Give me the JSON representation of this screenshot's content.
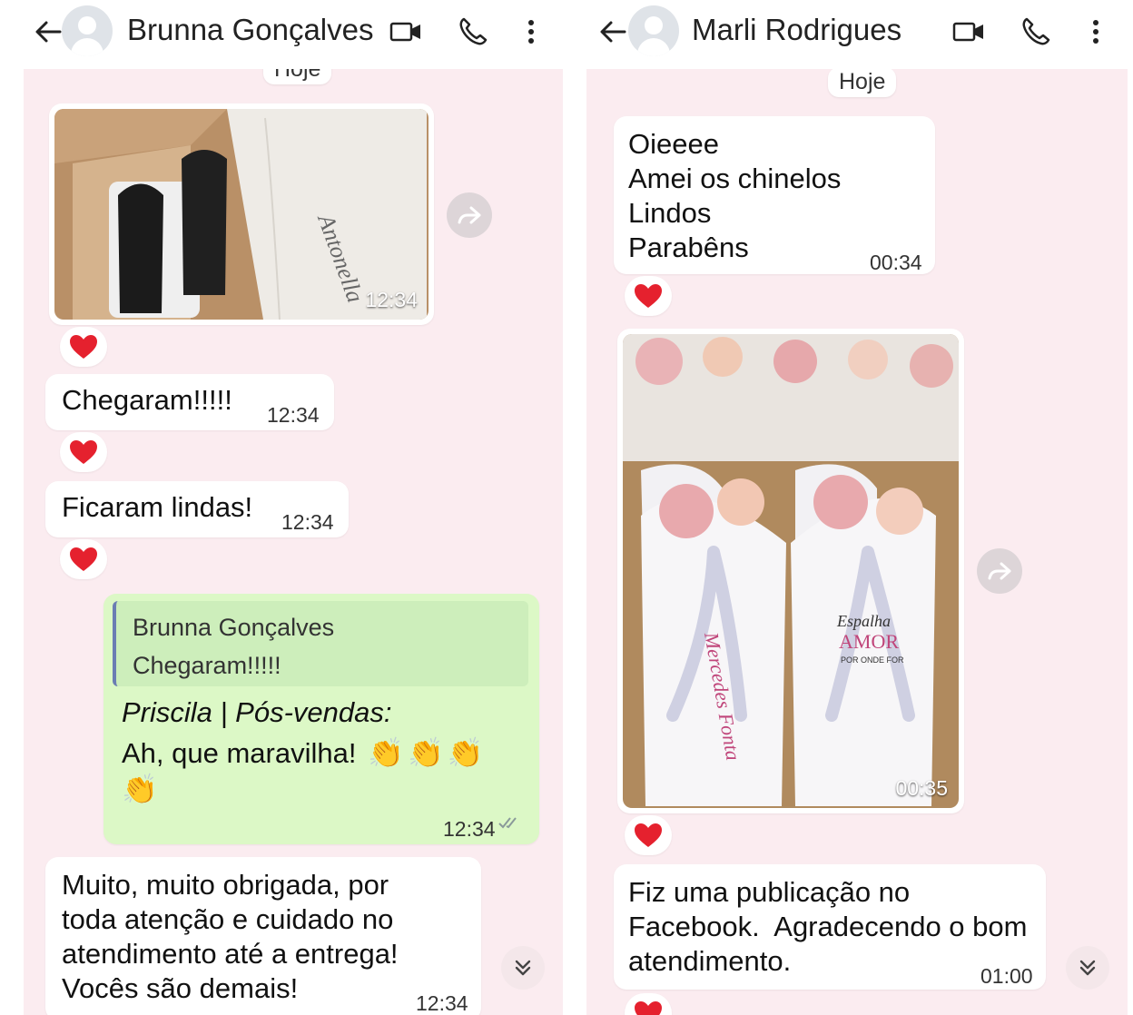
{
  "left": {
    "contact_name": "Brunna Gonçalves",
    "date_chip": "Hoje",
    "image_time": "12:34",
    "messages": [
      {
        "text": "Chegaram!!!!!",
        "time": "12:34"
      },
      {
        "text": "Ficaram lindas!",
        "time": "12:34"
      }
    ],
    "reply": {
      "quoted_author": "Brunna Gonçalves",
      "quoted_text": "Chegaram!!!!!",
      "sender": "Priscila | Pós-vendas:",
      "text": "Ah, que maravilha!",
      "emoji": "👏",
      "time": "12:34"
    },
    "last_message": {
      "text": "Muito, muito obrigada, por\ntoda atenção e cuidado no\natendimento até a entrega!\nVocês são demais!",
      "time": "12:34"
    }
  },
  "right": {
    "contact_name": "Marli Rodrigues",
    "date_chip": "Hoje",
    "first_message": {
      "text": "Oieeee\nAmei os chinelos\nLindos\nParabêns",
      "time": "00:34"
    },
    "image_time": "00:35",
    "last_message": {
      "text": "Fiz uma publicação no\nFacebook.  Agradecendo o bom\natendimento.",
      "time": "01:00"
    }
  },
  "colors": {
    "chat_background": "#fbecf0",
    "sent_bubble": "#dcf8c6",
    "heart": "#e5212e"
  },
  "icons": [
    "back-arrow-icon",
    "avatar-icon",
    "video-call-icon",
    "phone-icon",
    "more-options-icon",
    "heart-reaction-icon",
    "forward-icon",
    "scroll-down-icon",
    "read-ticks-icon"
  ]
}
